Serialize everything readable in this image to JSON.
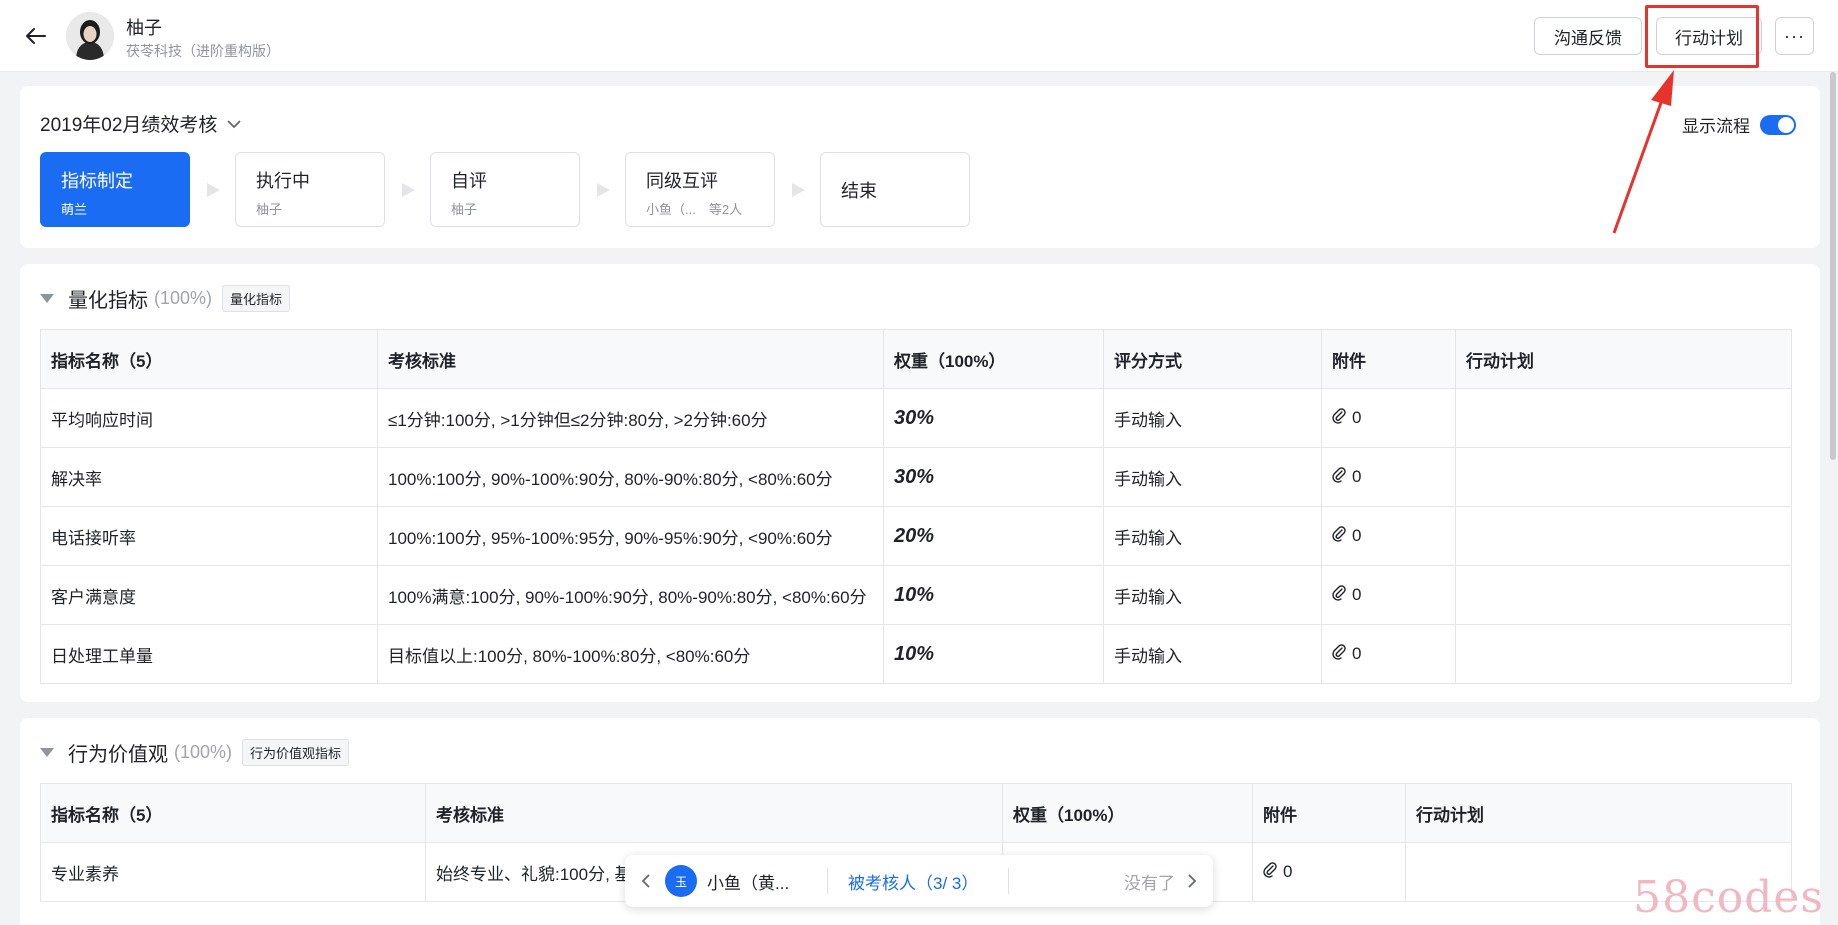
{
  "header": {
    "user_name": "柚子",
    "user_org": "茯苓科技（进阶重构版）",
    "feedback_label": "沟通反馈",
    "action_plan_label": "行动计划",
    "more_label": "···"
  },
  "review": {
    "period_label": "2019年02月绩效考核",
    "show_process_label": "显示流程",
    "show_process_on": true,
    "steps": [
      {
        "title": "指标制定",
        "sub": "萌兰",
        "active": true
      },
      {
        "title": "执行中",
        "sub": "柚子",
        "active": false
      },
      {
        "title": "自评",
        "sub": "柚子",
        "active": false
      },
      {
        "title": "同级互评",
        "sub": "小鱼（...　等2人",
        "active": false
      },
      {
        "title": "结束",
        "sub": "",
        "active": false
      }
    ]
  },
  "quant": {
    "title": "量化指标",
    "pct": "(100%)",
    "tag": "量化指标",
    "columns": [
      "指标名称（5）",
      "考核标准",
      "权重（100%）",
      "评分方式",
      "附件",
      "行动计划"
    ],
    "rows": [
      {
        "name": "平均响应时间",
        "standard": "≤1分钟:100分, >1分钟但≤2分钟:80分, >2分钟:60分",
        "weight": "30%",
        "method": "手动输入",
        "attach": "0",
        "plan": ""
      },
      {
        "name": "解决率",
        "standard": "100%:100分, 90%-100%:90分, 80%-90%:80分, <80%:60分",
        "weight": "30%",
        "method": "手动输入",
        "attach": "0",
        "plan": ""
      },
      {
        "name": "电话接听率",
        "standard": "100%:100分, 95%-100%:95分, 90%-95%:90分, <90%:60分",
        "weight": "20%",
        "method": "手动输入",
        "attach": "0",
        "plan": ""
      },
      {
        "name": "客户满意度",
        "standard": "100%满意:100分, 90%-100%:90分, 80%-90%:80分, <80%:60分",
        "weight": "10%",
        "method": "手动输入",
        "attach": "0",
        "plan": ""
      },
      {
        "name": "日处理工单量",
        "standard": "目标值以上:100分, 80%-100%:80分, <80%:60分",
        "weight": "10%",
        "method": "手动输入",
        "attach": "0",
        "plan": ""
      }
    ]
  },
  "behavior": {
    "title": "行为价值观",
    "pct": "(100%)",
    "tag": "行为价值观指标",
    "columns": [
      "指标名称（5）",
      "考核标准",
      "权重（100%）",
      "附件",
      "行动计划"
    ],
    "rows": [
      {
        "name": "专业素养",
        "standard": "始终专业、礼貌:100分, 基",
        "weight": "",
        "attach": "0",
        "plan": ""
      }
    ]
  },
  "navigator": {
    "avatar_text": "玉",
    "name": "小鱼（黄...",
    "count_label": "被考核人（3/ 3）",
    "end_label": "没有了"
  },
  "brand_watermark": "58codes",
  "colors": {
    "primary": "#1a6cf2",
    "annotation": "#e8322c"
  }
}
